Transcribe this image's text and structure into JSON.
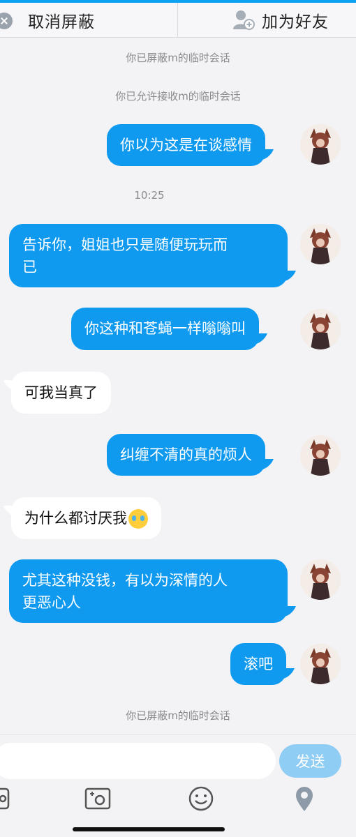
{
  "topbar": {
    "left_label": "取消屏蔽",
    "right_label": "加为好友"
  },
  "system": {
    "blocked_top": "你已屏蔽m的临时会话",
    "allowed": "你已允许接收m的临时会话",
    "blocked_bottom": "你已屏蔽m的临时会话"
  },
  "time_stamp": "10:25",
  "messages": [
    {
      "side": "me",
      "lines": [
        "你以为这是在谈感情"
      ]
    },
    {
      "side": "me",
      "lines": [
        "告诉你，姐姐也只是随便玩玩而",
        "已"
      ]
    },
    {
      "side": "me",
      "lines": [
        "你这种和苍蝇一样嗡嗡叫"
      ]
    },
    {
      "side": "them",
      "lines": [
        "可我当真了"
      ]
    },
    {
      "side": "me",
      "lines": [
        "纠缠不清的真的烦人"
      ]
    },
    {
      "side": "them",
      "lines": [
        "为什么都讨厌我"
      ],
      "emoji": "crying-face"
    },
    {
      "side": "me",
      "lines": [
        "尤其这种没钱，有以为深情的人",
        "更恶心人"
      ]
    },
    {
      "side": "me",
      "lines": [
        "滚吧"
      ]
    }
  ],
  "input": {
    "send_label": "发送"
  },
  "icons": {
    "block": "unblock-icon",
    "add_friend": "add-friend-icon",
    "photo": "photo-icon",
    "camera": "camera-icon",
    "emoji": "emoji-icon",
    "location": "location-icon"
  },
  "colors": {
    "accent": "#0f9af0",
    "send_disabled": "#8fcdf5"
  }
}
